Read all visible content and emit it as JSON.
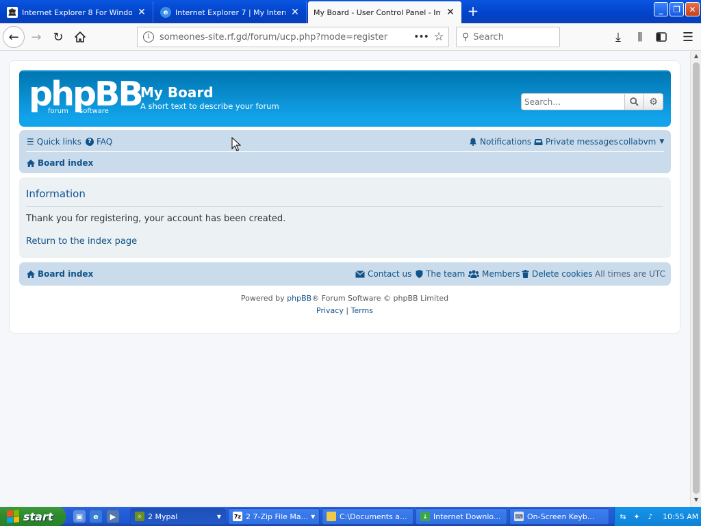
{
  "browser": {
    "tabs": [
      {
        "title": "Internet Explorer 8 For Windows XP",
        "icon": "columns-icon"
      },
      {
        "title": "Internet Explorer 7 | My Internet Explorer",
        "icon": "ie-icon"
      },
      {
        "title": "My Board - User Control Panel - Information",
        "icon": "none"
      }
    ],
    "new_tab_label": "+",
    "url": "someones-site.rf.gd/forum/ucp.php?mode=register",
    "search_placeholder": "Search",
    "window_controls": {
      "minimize": "_",
      "maximize": "❐",
      "close": "✕"
    }
  },
  "board": {
    "logo_text": "phpBB",
    "logo_sub_left": "forum",
    "logo_sub_right": "software",
    "site_title": "My Board",
    "site_description": "A short text to describe your forum",
    "search_placeholder": "Search…",
    "nav": {
      "quick_links": "Quick links",
      "faq": "FAQ",
      "notifications": "Notifications",
      "private_messages": "Private messages",
      "username": "collabvm",
      "breadcrumb": "Board index"
    },
    "panel": {
      "title": "Information",
      "message": "Thank you for registering, your account has been created.",
      "return_link": "Return to the index page"
    },
    "footer_nav": {
      "breadcrumb": "Board index",
      "contact": "Contact us",
      "team": "The team",
      "members": "Members",
      "delete_cookies": "Delete cookies",
      "timezone": "All times are UTC"
    },
    "copyright": {
      "prefix": "Powered by ",
      "link": "phpBB",
      "suffix": "® Forum Software © phpBB Limited"
    },
    "footer_links": {
      "privacy": "Privacy",
      "separator": " | ",
      "terms": "Terms"
    }
  },
  "taskbar": {
    "start_label": "start",
    "tasks": [
      {
        "label": "2 Mypal",
        "icon": "mypal-icon"
      },
      {
        "label": "2 7-Zip File Ma...",
        "icon": "7zip-icon"
      },
      {
        "label": "C:\\Documents a...",
        "icon": "folder-icon"
      },
      {
        "label": "Internet Downlo...",
        "icon": "download-manager-icon"
      },
      {
        "label": "On-Screen Keyb...",
        "icon": "keyboard-icon"
      }
    ],
    "clock": "10:55 AM"
  },
  "colors": {
    "header_blue": "#12a3eb",
    "navbar_bg": "#cadceb",
    "panel_bg": "#ecf1f3",
    "link": "#105289",
    "xp_blue": "#245edc",
    "start_green": "#2f8b2f"
  }
}
